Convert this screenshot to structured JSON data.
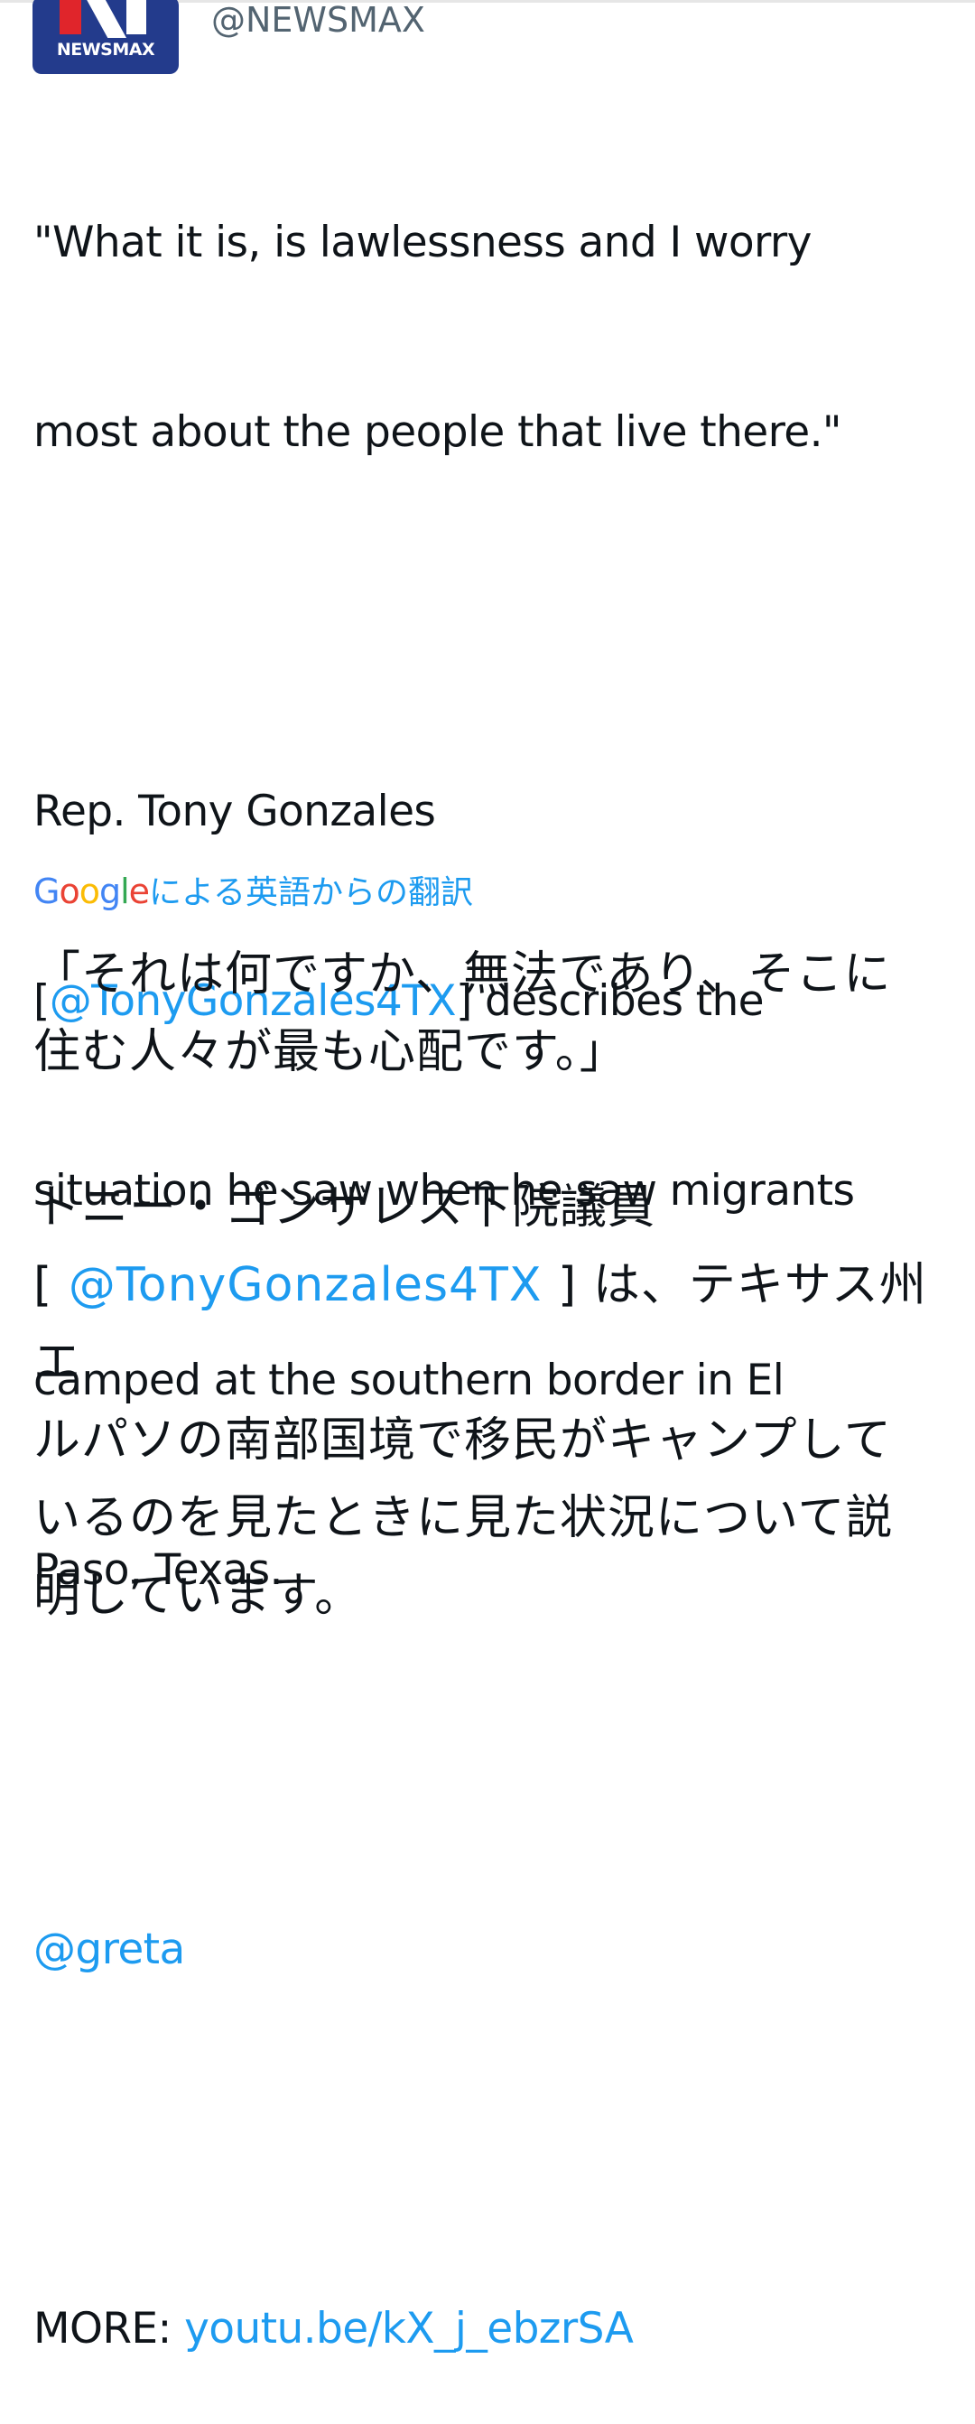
{
  "tweet": {
    "avatar_label": "NEWSMAX",
    "handle": "@NEWSMAX",
    "text": {
      "quote_line1": "\"What it is, is lawlessness and I worry",
      "quote_line2": "most about the people that live there.\"",
      "para2_line1": "Rep. Tony Gonzales",
      "para2_open_bracket": "[",
      "para2_mention": "@TonyGonzales4TX",
      "para2_line2_rest": "] describes the",
      "para2_line3": "situation he saw when he saw migrants",
      "para2_line4": "camped at the southern border in El",
      "para2_line5": "Paso, Texas.",
      "mention_greta": "@greta",
      "more_label": "MORE: ",
      "more_link": "youtu.be/kX_j_ebzrSA"
    },
    "translation": {
      "google_letters": [
        "G",
        "o",
        "o",
        "g",
        "l",
        "e"
      ],
      "label": "による英語からの翻訳",
      "jp_line1": "「それは何ですか、無法であり、そこに",
      "jp_line2": "住む人々が最も心配です。」",
      "jp_para2_line1": "トニー・ゴンザレス下院議員",
      "jp_para2_open": "[ ",
      "jp_para2_mention": "@TonyGonzales4TX",
      "jp_para2_line2_rest": " ] は、テキサス州エ",
      "jp_para2_line3": "ルパソの南部国境で移民がキャンプして",
      "jp_para2_line4": "いるのを見たときに見た状況について説",
      "jp_para2_line5": "明しています。"
    }
  },
  "colors": {
    "text": "#0f1419",
    "link": "#1d9bf0",
    "handle": "#536471",
    "newsmax_blue": "#233b8c",
    "newsmax_red": "#e0252b"
  }
}
